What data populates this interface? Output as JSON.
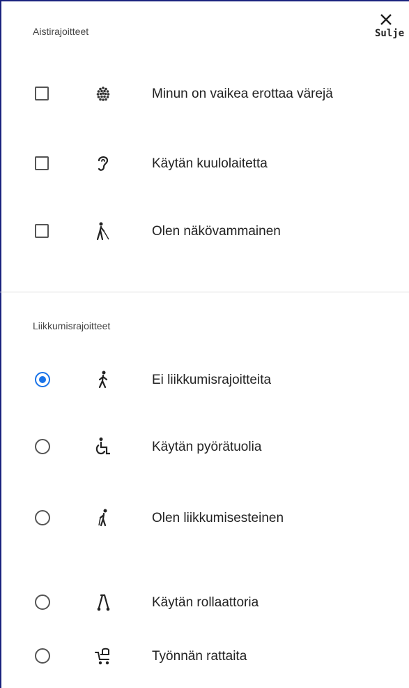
{
  "close": {
    "label": "Sulje",
    "icon": "close-icon"
  },
  "sensory": {
    "title": "Aistirajoitteet",
    "items": [
      {
        "label": "Minun on vaikea erottaa värejä",
        "icon": "color-blind-icon",
        "checked": false
      },
      {
        "label": "Käytän kuulolaitetta",
        "icon": "ear-icon",
        "checked": false
      },
      {
        "label": "Olen näkövammainen",
        "icon": "blind-person-icon",
        "checked": false
      }
    ]
  },
  "mobility": {
    "title": "Liikkumisrajoitteet",
    "items": [
      {
        "label": "Ei liikkumisrajoitteita",
        "icon": "walking-person-icon",
        "selected": true
      },
      {
        "label": "Käytän pyörätuolia",
        "icon": "wheelchair-icon",
        "selected": false
      },
      {
        "label": "Olen liikkumisesteinen",
        "icon": "person-with-cane-icon",
        "selected": false
      },
      {
        "label": "Käytän rollaattoria",
        "icon": "walker-icon",
        "selected": false
      },
      {
        "label": "Työnnän rattaita",
        "icon": "stroller-icon",
        "selected": false
      }
    ]
  },
  "colors": {
    "accent": "#1a73e8",
    "frame": "#1a237e",
    "divider": "#dddddd"
  }
}
